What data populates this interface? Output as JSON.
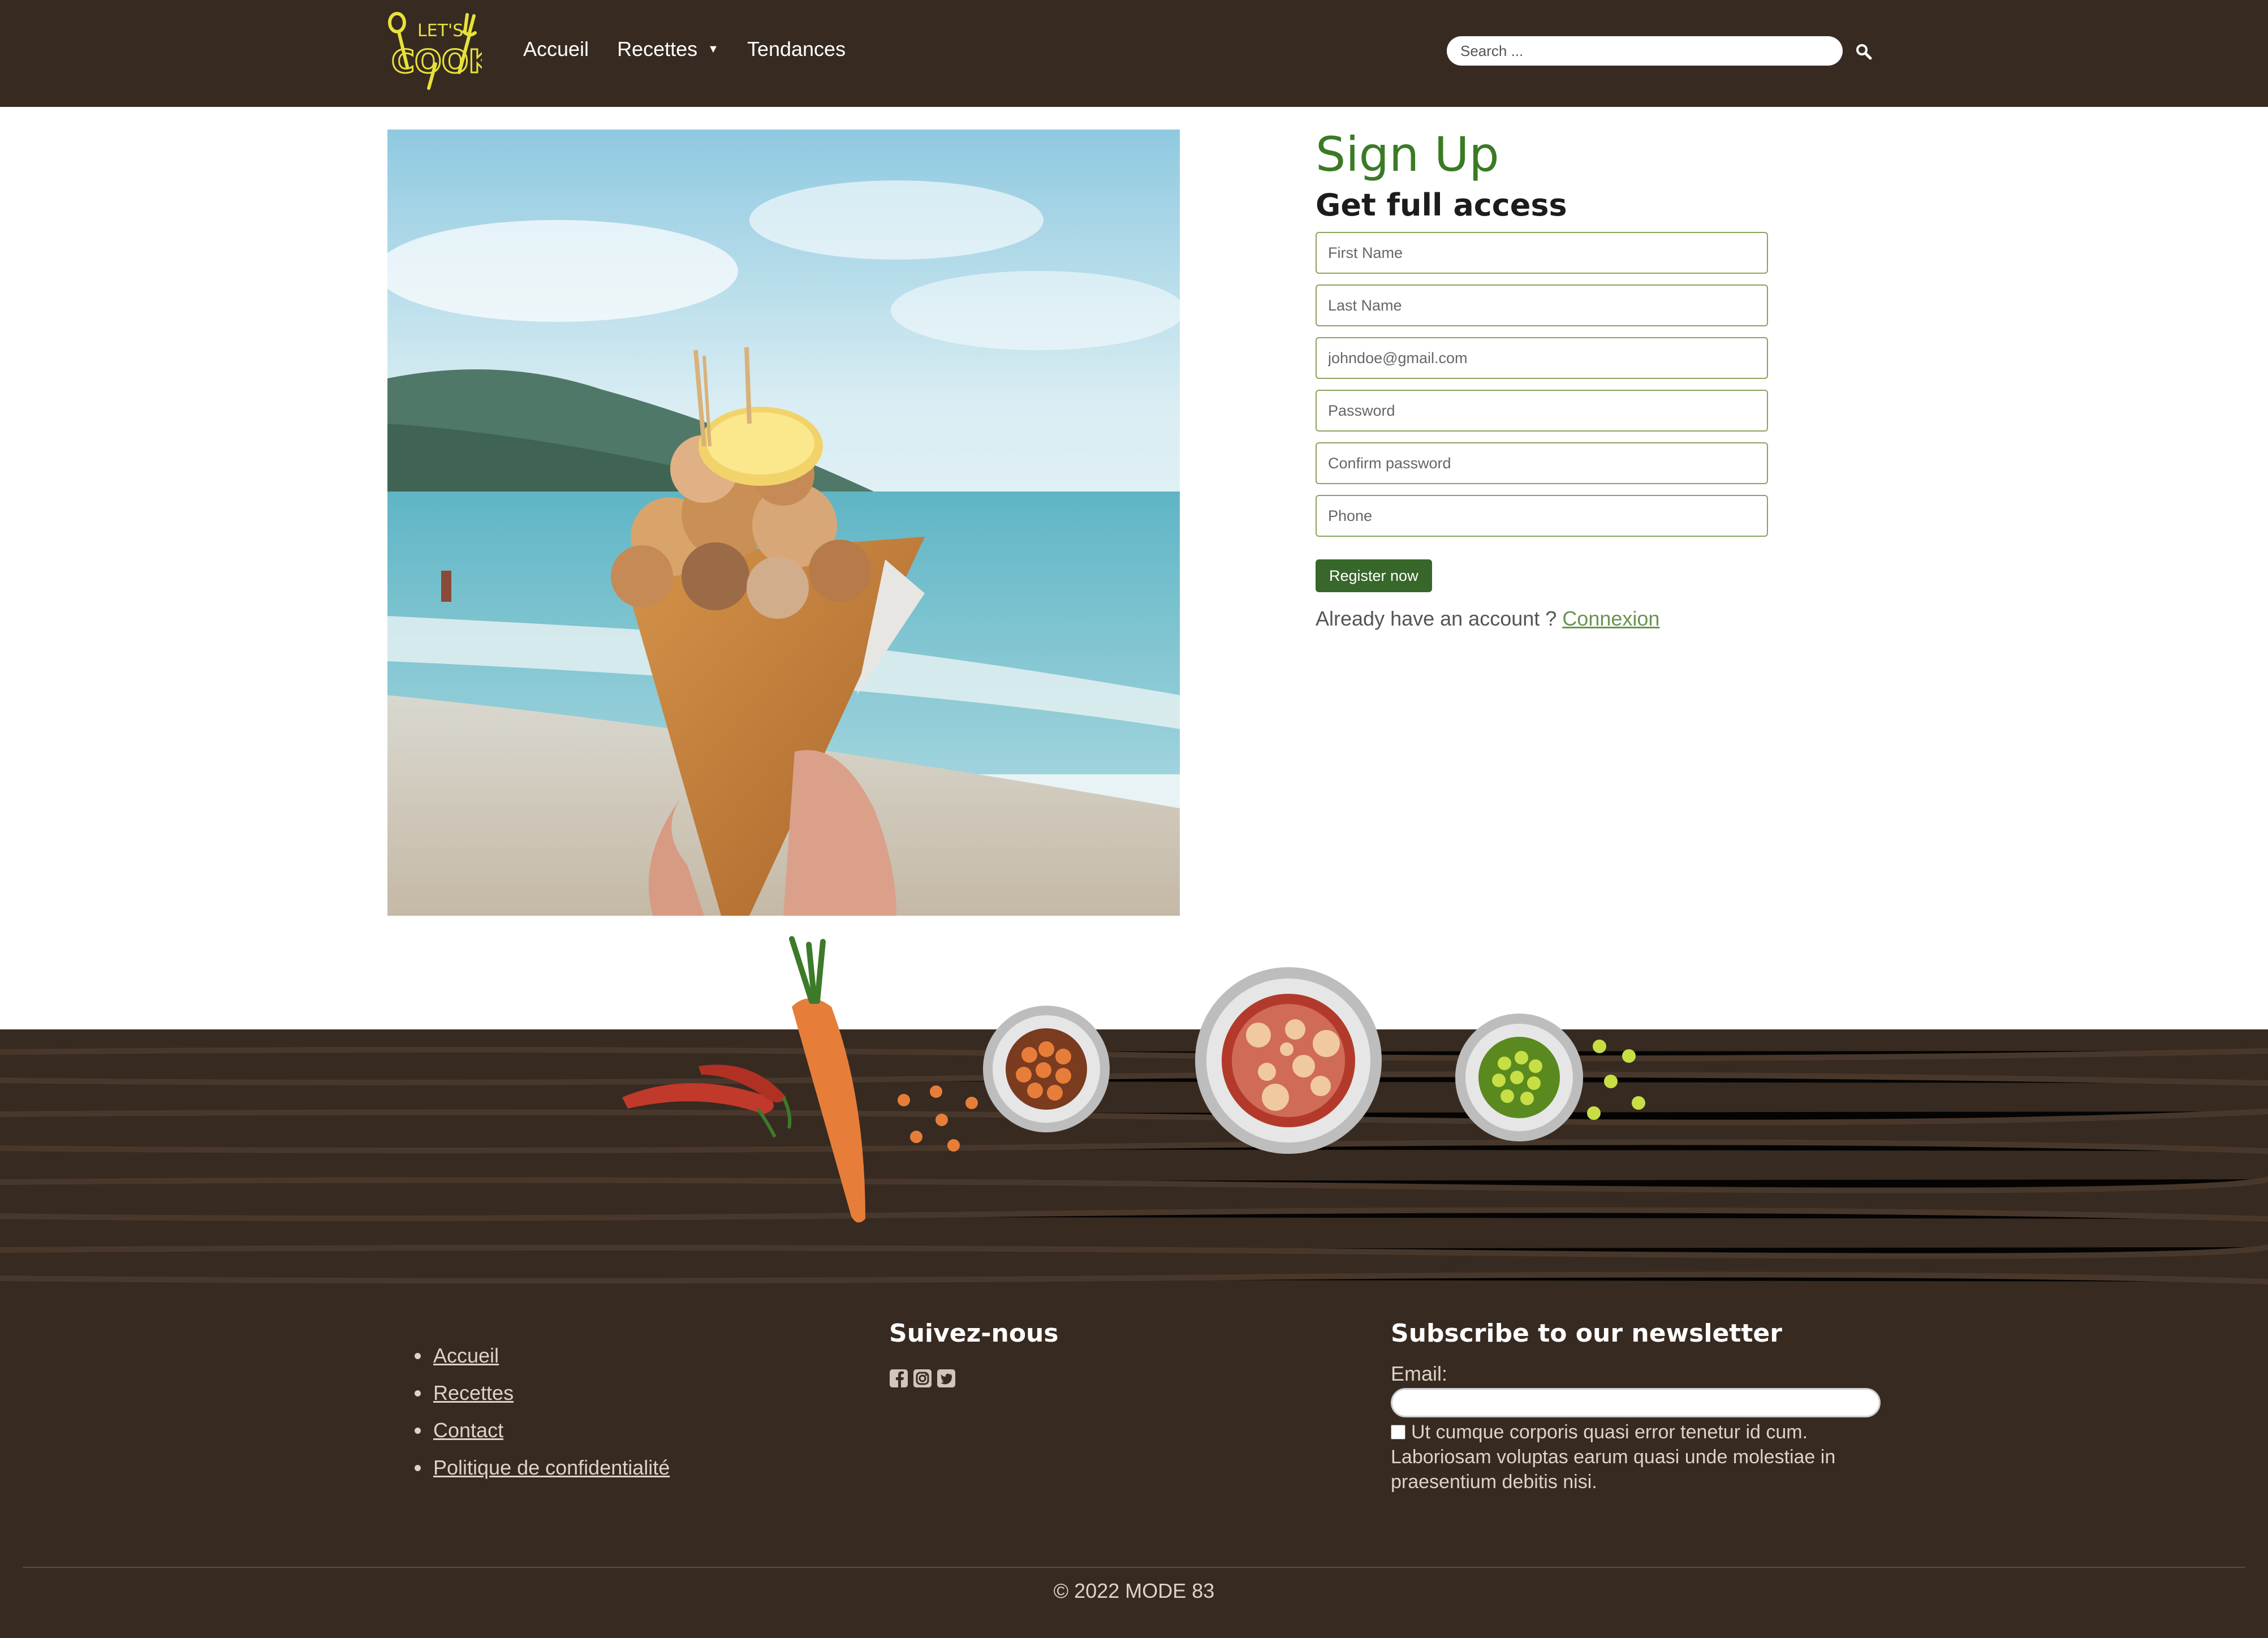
{
  "header": {
    "logo_text_top": "LET'S",
    "logo_text_bottom": "COOK",
    "nav": [
      {
        "label": "Accueil"
      },
      {
        "label": "Recettes",
        "has_dropdown": true
      },
      {
        "label": "Tendances"
      }
    ],
    "search": {
      "placeholder": "Search ..."
    },
    "search_icon": "search-icon"
  },
  "main": {
    "photo": "seafood-cone-at-beach",
    "title": "Sign Up",
    "subtitle": "Get full access",
    "fields": [
      {
        "placeholder": "First Name"
      },
      {
        "placeholder": "Last Name"
      },
      {
        "placeholder": "johndoe@gmail.com"
      },
      {
        "placeholder": "Password"
      },
      {
        "placeholder": "Confirm password"
      },
      {
        "placeholder": "Phone"
      }
    ],
    "register_label": "Register now",
    "already_text": "Already have an account ?",
    "login_link": "Connexion"
  },
  "footer": {
    "links": [
      "Accueil",
      "Recettes",
      "Contact",
      "Politique de confidentialité"
    ],
    "follow_title": "Suivez-nous",
    "social_icons": [
      "facebook-icon",
      "instagram-icon",
      "twitter-icon"
    ],
    "newsletter_title": "Subscribe to our newsletter",
    "email_label": "Email:",
    "consent_text": "Ut cumque corporis quasi error tenetur id cum. Laboriosam voluptas earum quasi unde molestiae in praesentium debitis nisi.",
    "copyright": "© 2022 MODE 83"
  },
  "colors": {
    "header_bg": "#372a21",
    "accent_green": "#3b7a25",
    "button_green": "#37672a",
    "field_border": "#8aa35d",
    "logo_yellow": "#e6e23a"
  }
}
